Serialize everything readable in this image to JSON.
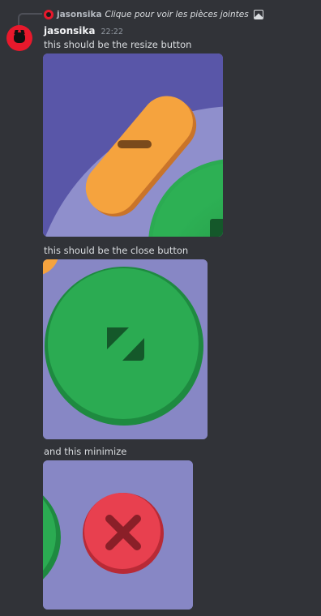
{
  "reply": {
    "author": "jasonsika",
    "text": "Clique pour voir les pièces jointes",
    "icon": "image-icon"
  },
  "message": {
    "username": "jasonsika",
    "timestamp": "22:22",
    "avatar_color": "#e8192c"
  },
  "posts": [
    {
      "text": "this should be the resize button",
      "attachment": "orange-minus-button"
    },
    {
      "text": "this should be the close button",
      "attachment": "green-resize-button"
    },
    {
      "text": "and this minimize",
      "attachment": "red-close-button"
    }
  ],
  "colors": {
    "background": "#313338",
    "purple": "#8787c5",
    "orange": "#f5a33e",
    "green": "#2bab52",
    "red": "#e8404f"
  }
}
